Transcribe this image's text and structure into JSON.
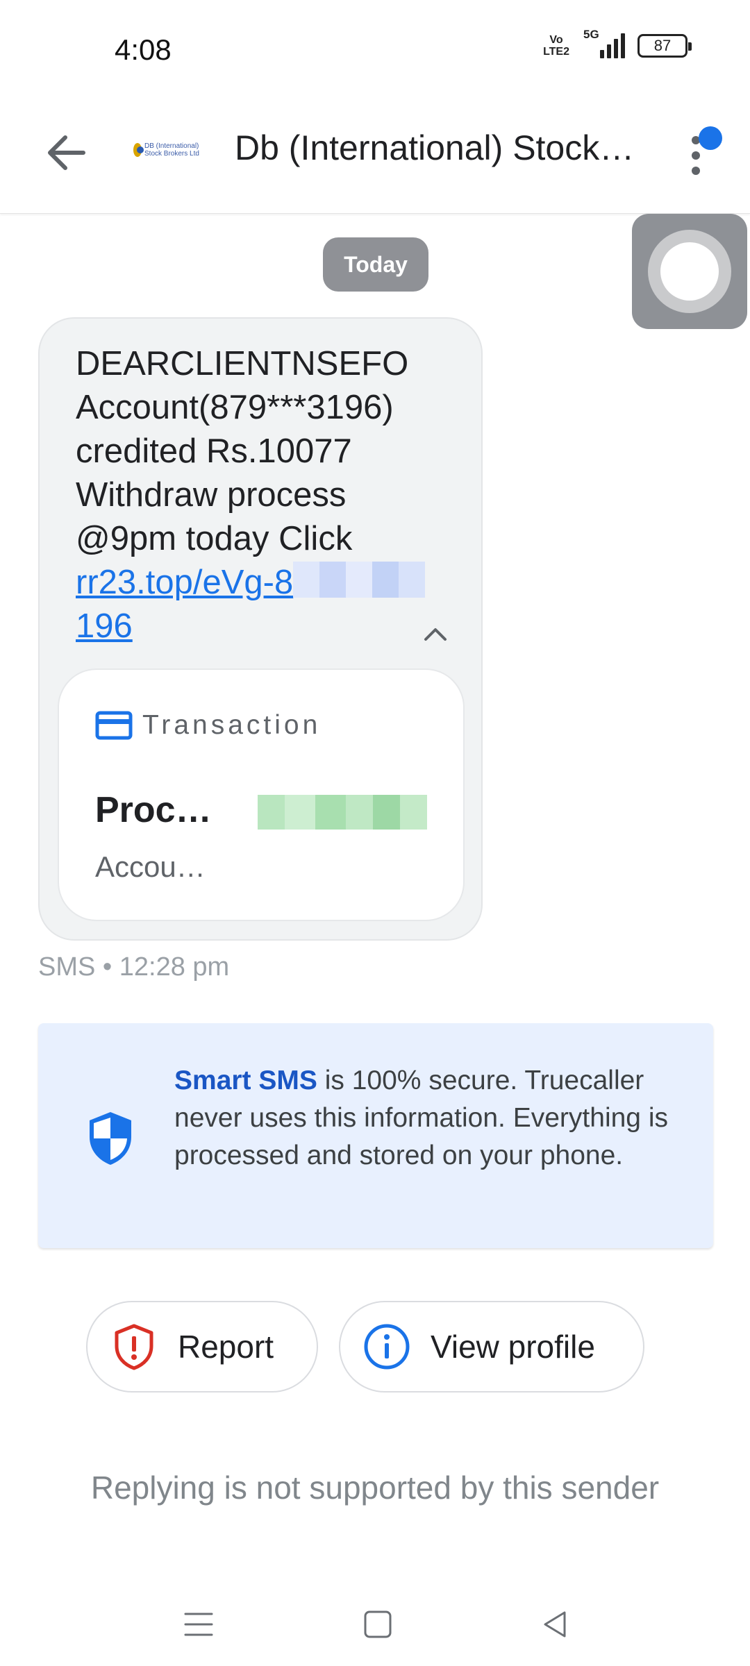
{
  "status_bar": {
    "time": "4:08",
    "volte_line1": "Vo",
    "volte_line2": "LTE2",
    "network": "5G",
    "battery": "87"
  },
  "app_bar": {
    "logo_text": "DB (International) Stock Brokers Ltd",
    "sender_name": "Db (International) Stock Brokers",
    "notification_dot_color": "#1a73e8"
  },
  "conversation": {
    "date_chip": "Today",
    "message": {
      "text_before_link": "DEARCLIENTNSEFO Account(879***3196) credited Rs.10077 Withdraw process @9pm today Click ",
      "link_start": "rr23.top/eVg-8",
      "link_end": "196",
      "meta": "SMS • 12:28 pm"
    },
    "transaction_card": {
      "label": "Transaction",
      "title": "Proc…",
      "subtitle": "Accou…"
    }
  },
  "security_banner": {
    "strong": "Smart SMS",
    "text": " is 100% secure. Truecaller never uses this information. Everything is processed and stored on your phone."
  },
  "actions": {
    "report_label": "Report",
    "view_profile_label": "View profile"
  },
  "reply_note": "Replying is not supported by this sender",
  "colors": {
    "accent": "#1a73e8",
    "report_red": "#d93025",
    "banner_bg": "#e8f0fe"
  }
}
